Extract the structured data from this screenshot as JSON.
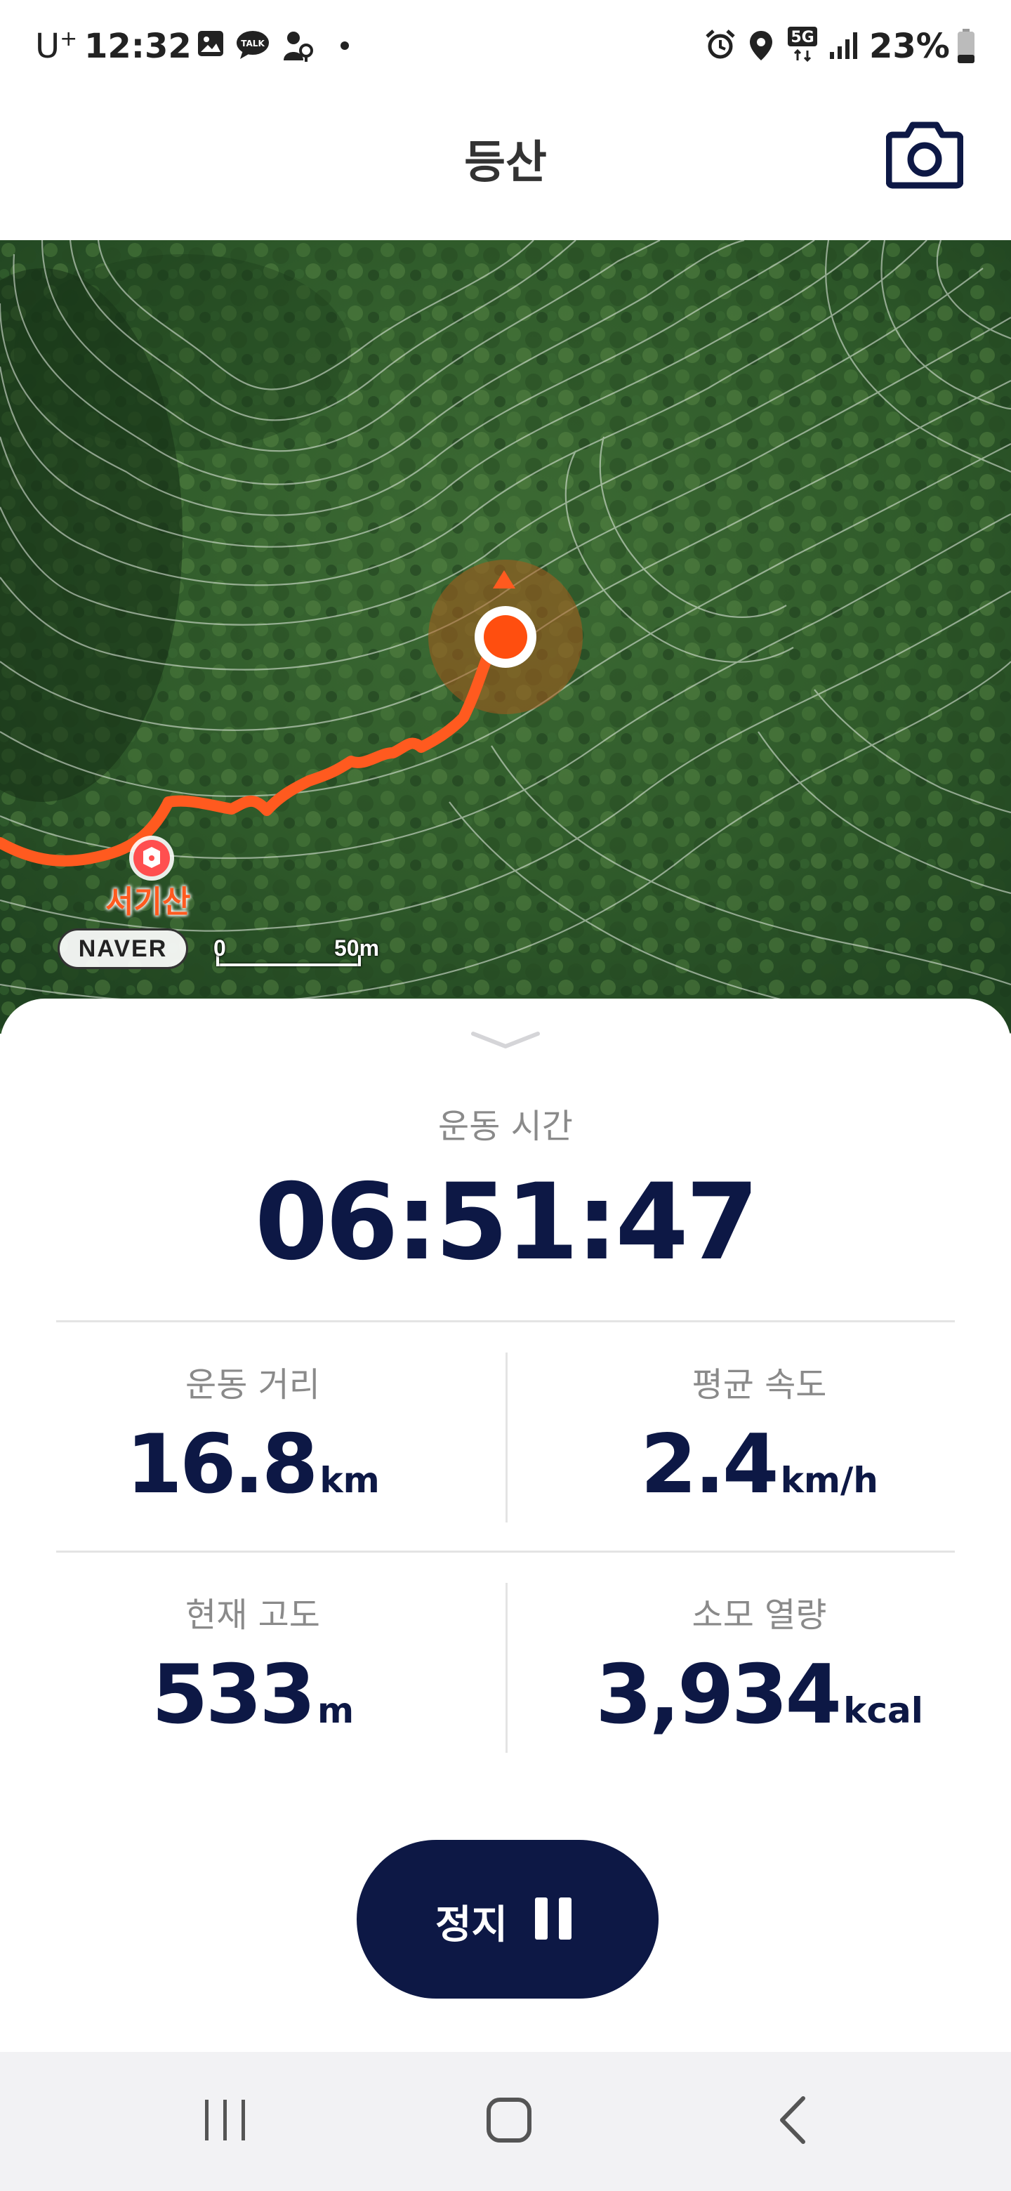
{
  "status_bar": {
    "carrier": "U",
    "carrier_sup": "+",
    "time": "12:32",
    "battery": "23%",
    "network": "5G",
    "icons": [
      "gallery-icon",
      "talk-icon",
      "accessibility-icon",
      "dot-icon",
      "alarm-icon",
      "location-icon",
      "5g-icon",
      "signal-icon",
      "battery-icon"
    ],
    "notification_talk_badge": "TALK"
  },
  "header": {
    "title": "등산",
    "camera_icon": "camera-icon"
  },
  "map": {
    "poi_name": "서기산",
    "provider": "NAVER",
    "scale_start": "0",
    "scale_end": "50m",
    "route_color": "#ff5a1f"
  },
  "workout": {
    "duration_label": "운동 시간",
    "duration": "06:51:47",
    "distance_label": "운동 거리",
    "distance": "16.8",
    "distance_unit": "km",
    "speed_label": "평균 속도",
    "speed": "2.4",
    "speed_unit": "km/h",
    "altitude_label": "현재 고도",
    "altitude": "533",
    "altitude_unit": "m",
    "calories_label": "소모 열량",
    "calories": "3,934",
    "calories_unit": "kcal"
  },
  "controls": {
    "stop_label": "정지",
    "stop_icon": "pause-icon"
  },
  "nav_bar": {
    "buttons": [
      "recent-apps-icon",
      "home-icon",
      "back-icon"
    ]
  },
  "colors": {
    "primary_navy": "#0d1845",
    "accent_orange": "#ff5a1f",
    "label_gray": "#8a8a8a"
  }
}
